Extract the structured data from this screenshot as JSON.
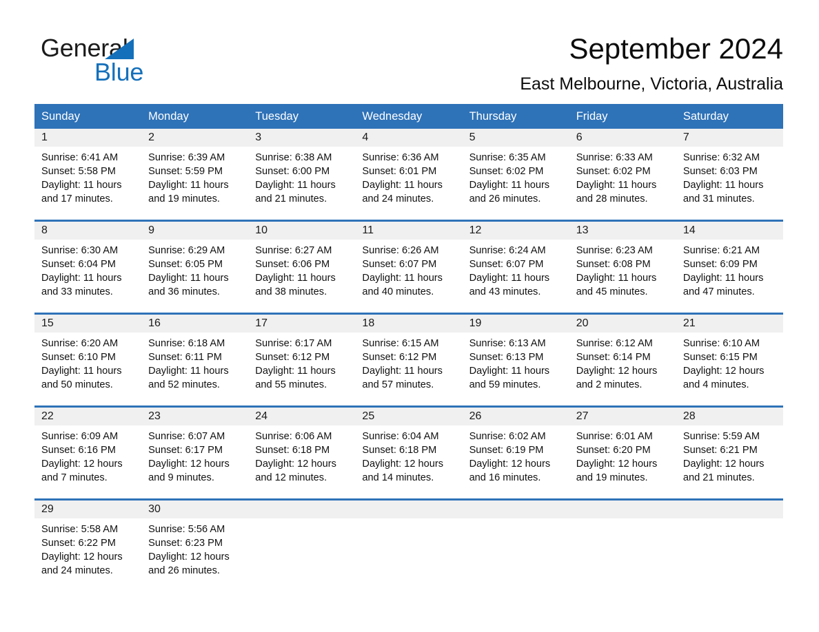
{
  "brand": {
    "word_one": "General",
    "word_two": "Blue",
    "triangle_icon": "triangle-icon",
    "accent_color": "#1470bb"
  },
  "header": {
    "month_title": "September 2024",
    "location": "East Melbourne, Victoria, Australia"
  },
  "theme": {
    "header_blue": "#2e72b8",
    "day_band_gray": "#f0f0f0",
    "page_background": "#ffffff"
  },
  "calendar": {
    "weekday_headers": [
      "Sunday",
      "Monday",
      "Tuesday",
      "Wednesday",
      "Thursday",
      "Friday",
      "Saturday"
    ],
    "weeks": [
      [
        {
          "day": "1",
          "sunrise": "Sunrise: 6:41 AM",
          "sunset": "Sunset: 5:58 PM",
          "daylight": "Daylight: 11 hours and 17 minutes."
        },
        {
          "day": "2",
          "sunrise": "Sunrise: 6:39 AM",
          "sunset": "Sunset: 5:59 PM",
          "daylight": "Daylight: 11 hours and 19 minutes."
        },
        {
          "day": "3",
          "sunrise": "Sunrise: 6:38 AM",
          "sunset": "Sunset: 6:00 PM",
          "daylight": "Daylight: 11 hours and 21 minutes."
        },
        {
          "day": "4",
          "sunrise": "Sunrise: 6:36 AM",
          "sunset": "Sunset: 6:01 PM",
          "daylight": "Daylight: 11 hours and 24 minutes."
        },
        {
          "day": "5",
          "sunrise": "Sunrise: 6:35 AM",
          "sunset": "Sunset: 6:02 PM",
          "daylight": "Daylight: 11 hours and 26 minutes."
        },
        {
          "day": "6",
          "sunrise": "Sunrise: 6:33 AM",
          "sunset": "Sunset: 6:02 PM",
          "daylight": "Daylight: 11 hours and 28 minutes."
        },
        {
          "day": "7",
          "sunrise": "Sunrise: 6:32 AM",
          "sunset": "Sunset: 6:03 PM",
          "daylight": "Daylight: 11 hours and 31 minutes."
        }
      ],
      [
        {
          "day": "8",
          "sunrise": "Sunrise: 6:30 AM",
          "sunset": "Sunset: 6:04 PM",
          "daylight": "Daylight: 11 hours and 33 minutes."
        },
        {
          "day": "9",
          "sunrise": "Sunrise: 6:29 AM",
          "sunset": "Sunset: 6:05 PM",
          "daylight": "Daylight: 11 hours and 36 minutes."
        },
        {
          "day": "10",
          "sunrise": "Sunrise: 6:27 AM",
          "sunset": "Sunset: 6:06 PM",
          "daylight": "Daylight: 11 hours and 38 minutes."
        },
        {
          "day": "11",
          "sunrise": "Sunrise: 6:26 AM",
          "sunset": "Sunset: 6:07 PM",
          "daylight": "Daylight: 11 hours and 40 minutes."
        },
        {
          "day": "12",
          "sunrise": "Sunrise: 6:24 AM",
          "sunset": "Sunset: 6:07 PM",
          "daylight": "Daylight: 11 hours and 43 minutes."
        },
        {
          "day": "13",
          "sunrise": "Sunrise: 6:23 AM",
          "sunset": "Sunset: 6:08 PM",
          "daylight": "Daylight: 11 hours and 45 minutes."
        },
        {
          "day": "14",
          "sunrise": "Sunrise: 6:21 AM",
          "sunset": "Sunset: 6:09 PM",
          "daylight": "Daylight: 11 hours and 47 minutes."
        }
      ],
      [
        {
          "day": "15",
          "sunrise": "Sunrise: 6:20 AM",
          "sunset": "Sunset: 6:10 PM",
          "daylight": "Daylight: 11 hours and 50 minutes."
        },
        {
          "day": "16",
          "sunrise": "Sunrise: 6:18 AM",
          "sunset": "Sunset: 6:11 PM",
          "daylight": "Daylight: 11 hours and 52 minutes."
        },
        {
          "day": "17",
          "sunrise": "Sunrise: 6:17 AM",
          "sunset": "Sunset: 6:12 PM",
          "daylight": "Daylight: 11 hours and 55 minutes."
        },
        {
          "day": "18",
          "sunrise": "Sunrise: 6:15 AM",
          "sunset": "Sunset: 6:12 PM",
          "daylight": "Daylight: 11 hours and 57 minutes."
        },
        {
          "day": "19",
          "sunrise": "Sunrise: 6:13 AM",
          "sunset": "Sunset: 6:13 PM",
          "daylight": "Daylight: 11 hours and 59 minutes."
        },
        {
          "day": "20",
          "sunrise": "Sunrise: 6:12 AM",
          "sunset": "Sunset: 6:14 PM",
          "daylight": "Daylight: 12 hours and 2 minutes."
        },
        {
          "day": "21",
          "sunrise": "Sunrise: 6:10 AM",
          "sunset": "Sunset: 6:15 PM",
          "daylight": "Daylight: 12 hours and 4 minutes."
        }
      ],
      [
        {
          "day": "22",
          "sunrise": "Sunrise: 6:09 AM",
          "sunset": "Sunset: 6:16 PM",
          "daylight": "Daylight: 12 hours and 7 minutes."
        },
        {
          "day": "23",
          "sunrise": "Sunrise: 6:07 AM",
          "sunset": "Sunset: 6:17 PM",
          "daylight": "Daylight: 12 hours and 9 minutes."
        },
        {
          "day": "24",
          "sunrise": "Sunrise: 6:06 AM",
          "sunset": "Sunset: 6:18 PM",
          "daylight": "Daylight: 12 hours and 12 minutes."
        },
        {
          "day": "25",
          "sunrise": "Sunrise: 6:04 AM",
          "sunset": "Sunset: 6:18 PM",
          "daylight": "Daylight: 12 hours and 14 minutes."
        },
        {
          "day": "26",
          "sunrise": "Sunrise: 6:02 AM",
          "sunset": "Sunset: 6:19 PM",
          "daylight": "Daylight: 12 hours and 16 minutes."
        },
        {
          "day": "27",
          "sunrise": "Sunrise: 6:01 AM",
          "sunset": "Sunset: 6:20 PM",
          "daylight": "Daylight: 12 hours and 19 minutes."
        },
        {
          "day": "28",
          "sunrise": "Sunrise: 5:59 AM",
          "sunset": "Sunset: 6:21 PM",
          "daylight": "Daylight: 12 hours and 21 minutes."
        }
      ],
      [
        {
          "day": "29",
          "sunrise": "Sunrise: 5:58 AM",
          "sunset": "Sunset: 6:22 PM",
          "daylight": "Daylight: 12 hours and 24 minutes."
        },
        {
          "day": "30",
          "sunrise": "Sunrise: 5:56 AM",
          "sunset": "Sunset: 6:23 PM",
          "daylight": "Daylight: 12 hours and 26 minutes."
        },
        {
          "day": "",
          "sunrise": "",
          "sunset": "",
          "daylight": ""
        },
        {
          "day": "",
          "sunrise": "",
          "sunset": "",
          "daylight": ""
        },
        {
          "day": "",
          "sunrise": "",
          "sunset": "",
          "daylight": ""
        },
        {
          "day": "",
          "sunrise": "",
          "sunset": "",
          "daylight": ""
        },
        {
          "day": "",
          "sunrise": "",
          "sunset": "",
          "daylight": ""
        }
      ]
    ]
  }
}
